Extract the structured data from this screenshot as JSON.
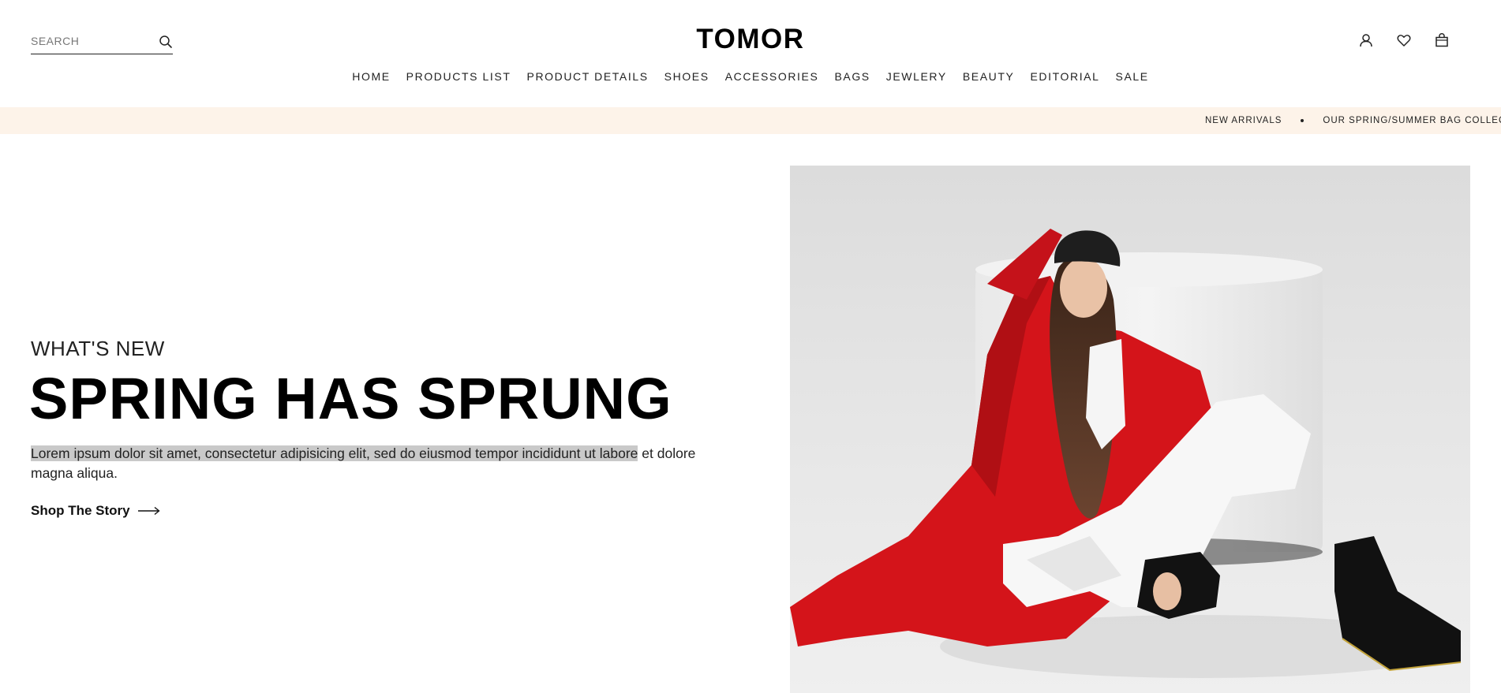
{
  "header": {
    "search_placeholder": "SEARCH",
    "logo": "TOMOR",
    "icons": [
      "user-icon",
      "heart-icon",
      "bag-icon"
    ]
  },
  "nav": {
    "items": [
      {
        "label": "HOME"
      },
      {
        "label": "PRODUCTS LIST"
      },
      {
        "label": "PRODUCT DETAILS"
      },
      {
        "label": "SHOES"
      },
      {
        "label": "ACCESSORIES"
      },
      {
        "label": "BAGS"
      },
      {
        "label": "JEWLERY"
      },
      {
        "label": "BEAUTY"
      },
      {
        "label": "EDITORIAL"
      },
      {
        "label": "SALE"
      }
    ]
  },
  "announcement": {
    "items": [
      "NEW ARRIVALS",
      "OUR SPRING/SUMMER BAG COLLECTION"
    ]
  },
  "hero": {
    "subtitle": "WHAT'S NEW",
    "title": "SPRING HAS SPRUNG",
    "text_highlighted": "Lorem ipsum dolor sit amet, consectetur adipisicing elit, sed do eiusmod tempor incididunt ut labore",
    "text_rest": " et dolore magna aliqua.",
    "cta_label": "Shop The Story"
  },
  "colors": {
    "announcement_bg": "#fdf3e9",
    "highlight": "#c9c9c9",
    "coat_red": "#d4141a",
    "image_bg": "#e4e4e4"
  }
}
